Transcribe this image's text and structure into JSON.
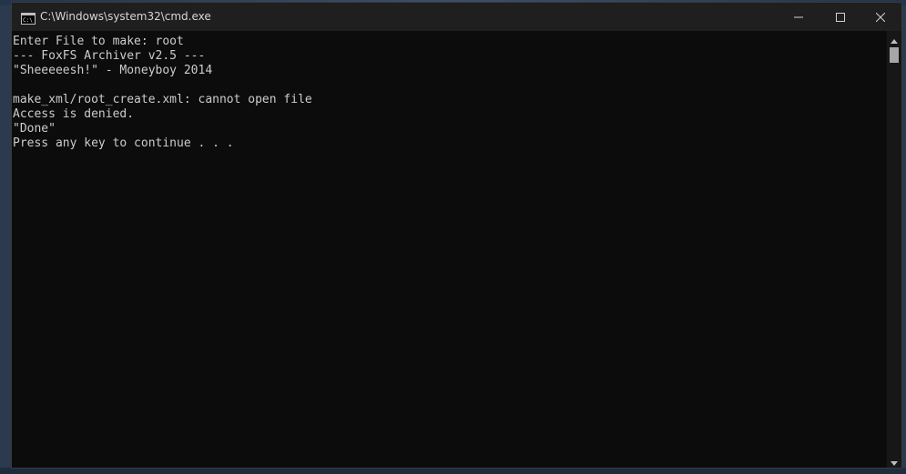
{
  "window": {
    "title": "C:\\Windows\\system32\\cmd.exe",
    "icon": "cmd-icon",
    "controls": {
      "minimize": "minimize-icon",
      "maximize": "maximize-icon",
      "close": "close-icon"
    }
  },
  "console": {
    "lines": [
      "Enter File to make: root",
      "--- FoxFS Archiver v2.5 ---",
      "\"Sheeeeesh!\" - Moneyboy 2014",
      "",
      "make_xml/root_create.xml: cannot open file",
      "Access is denied.",
      "\"Done\"",
      "Press any key to continue . . ."
    ],
    "text_color": "#cccccc",
    "background": "#0c0c0c"
  },
  "scrollbar": {
    "up_icon": "scroll-up-arrow-icon",
    "down_icon": "scroll-down-arrow-icon"
  }
}
